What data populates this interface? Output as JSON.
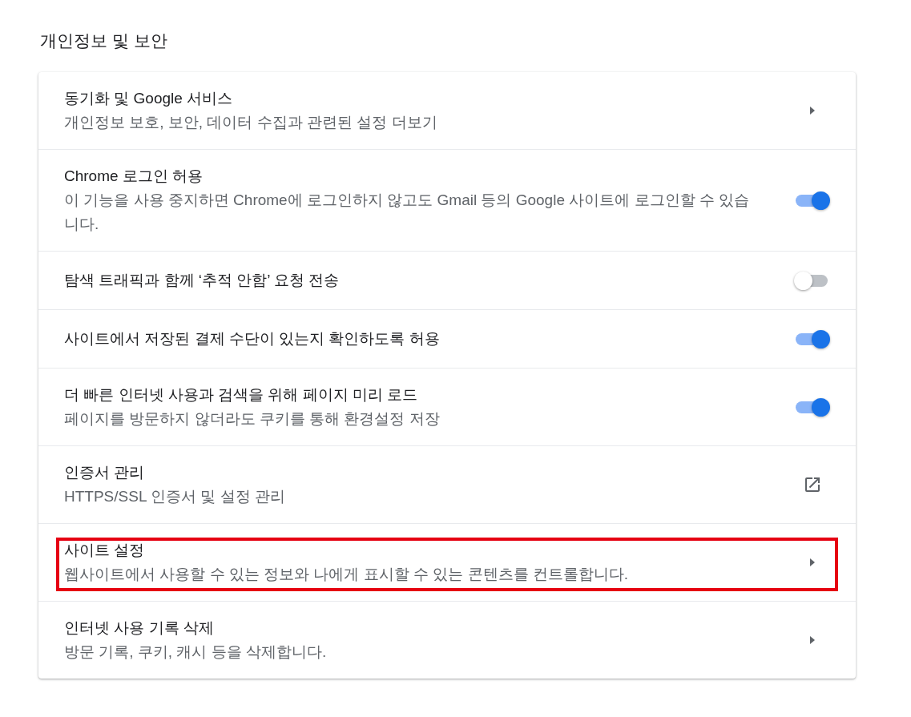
{
  "section": {
    "title": "개인정보 및 보안"
  },
  "items": [
    {
      "kind": "arrow",
      "title": "동기화 및 Google 서비스",
      "subtitle": "개인정보 보호, 보안, 데이터 수집과 관련된 설정 더보기",
      "highlighted": false
    },
    {
      "kind": "toggle",
      "title": "Chrome 로그인 허용",
      "subtitle": "이 기능을 사용 중지하면 Chrome에 로그인하지 않고도 Gmail 등의 Google 사이트에 로그인할 수 있습니다.",
      "on": true,
      "highlighted": false
    },
    {
      "kind": "toggle",
      "title": "탐색 트래픽과 함께 ‘추적 안함’ 요청 전송",
      "on": false,
      "highlighted": false
    },
    {
      "kind": "toggle",
      "title": "사이트에서 저장된 결제 수단이 있는지 확인하도록 허용",
      "on": true,
      "highlighted": false
    },
    {
      "kind": "toggle",
      "title": "더 빠른 인터넷 사용과 검색을 위해 페이지 미리 로드",
      "subtitle": "페이지를 방문하지 않더라도 쿠키를 통해 환경설정 저장",
      "on": true,
      "highlighted": false
    },
    {
      "kind": "external",
      "title": "인증서 관리",
      "subtitle": "HTTPS/SSL 인증서 및 설정 관리",
      "highlighted": false
    },
    {
      "kind": "arrow",
      "title": "사이트 설정",
      "subtitle": "웹사이트에서 사용할 수 있는 정보와 나에게 표시할 수 있는 콘텐츠를 컨트롤합니다.",
      "highlighted": true
    },
    {
      "kind": "arrow",
      "title": "인터넷 사용 기록 삭제",
      "subtitle": "방문 기록, 쿠키, 캐시 등을 삭제합니다.",
      "highlighted": false
    }
  ]
}
